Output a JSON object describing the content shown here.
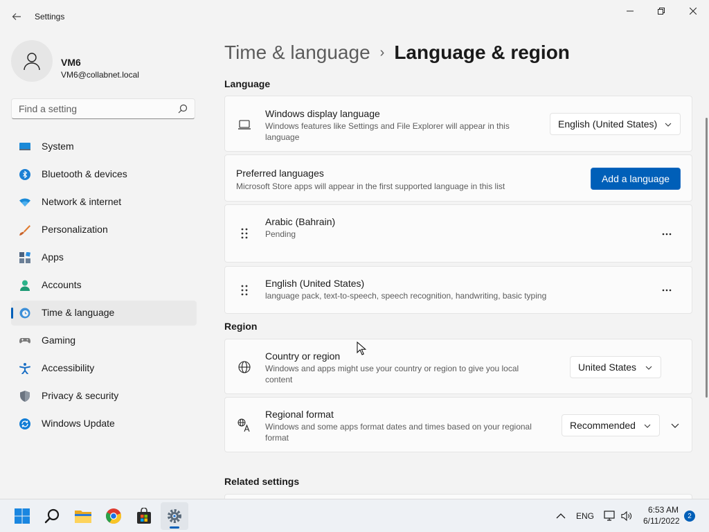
{
  "window": {
    "title": "Settings"
  },
  "profile": {
    "name": "VM6",
    "email": "VM6@collabnet.local"
  },
  "search": {
    "placeholder": "Find a setting"
  },
  "sidebar": {
    "items": [
      {
        "label": "System",
        "icon": "system-icon",
        "color": "#0078d4"
      },
      {
        "label": "Bluetooth & devices",
        "icon": "bluetooth-icon",
        "color": "#0078d4"
      },
      {
        "label": "Network & internet",
        "icon": "network-icon",
        "color": "#0a84d8"
      },
      {
        "label": "Personalization",
        "icon": "brush-icon",
        "color": "#e8792b"
      },
      {
        "label": "Apps",
        "icon": "apps-icon",
        "color": "#5a6b7d"
      },
      {
        "label": "Accounts",
        "icon": "accounts-icon",
        "color": "#23a57d"
      },
      {
        "label": "Time & language",
        "icon": "time-language-icon",
        "color": "#0078d4"
      },
      {
        "label": "Gaming",
        "icon": "gaming-icon",
        "color": "#6b6b6b"
      },
      {
        "label": "Accessibility",
        "icon": "accessibility-icon",
        "color": "#1a73c8"
      },
      {
        "label": "Privacy & security",
        "icon": "shield-icon",
        "color": "#6b7480"
      },
      {
        "label": "Windows Update",
        "icon": "windows-update-icon",
        "color": "#0f7bd6"
      }
    ],
    "selected": "Time & language"
  },
  "breadcrumb": {
    "parent": "Time & language",
    "separator": "›",
    "current": "Language & region"
  },
  "language": {
    "section_title": "Language",
    "display_language": {
      "title": "Windows display language",
      "description": "Windows features like Settings and File Explorer will appear in this language",
      "value": "English (United States)"
    },
    "preferred": {
      "title": "Preferred languages",
      "description": "Microsoft Store apps will appear in the first supported language in this list",
      "button": "Add a language"
    },
    "languages": [
      {
        "name": "Arabic (Bahrain)",
        "detail": "Pending"
      },
      {
        "name": "English (United States)",
        "detail": "language pack, text-to-speech, speech recognition, handwriting, basic typing"
      }
    ]
  },
  "region": {
    "section_title": "Region",
    "country": {
      "title": "Country or region",
      "description": "Windows and apps might use your country or region to give you local content",
      "value": "United States"
    },
    "format": {
      "title": "Regional format",
      "description": "Windows and some apps format dates and times based on your regional format",
      "value": "Recommended"
    }
  },
  "related": {
    "section_title": "Related settings"
  },
  "taskbar": {
    "apps": [
      "start-icon",
      "search-icon",
      "file-explorer-icon",
      "chrome-icon",
      "store-icon",
      "settings-icon"
    ],
    "language": "ENG",
    "time": "6:53 AM",
    "date": "6/11/2022",
    "notifications": "2"
  },
  "colors": {
    "accent": "#005fb8",
    "background": "#f3f3f3",
    "card": "#fbfbfb"
  }
}
